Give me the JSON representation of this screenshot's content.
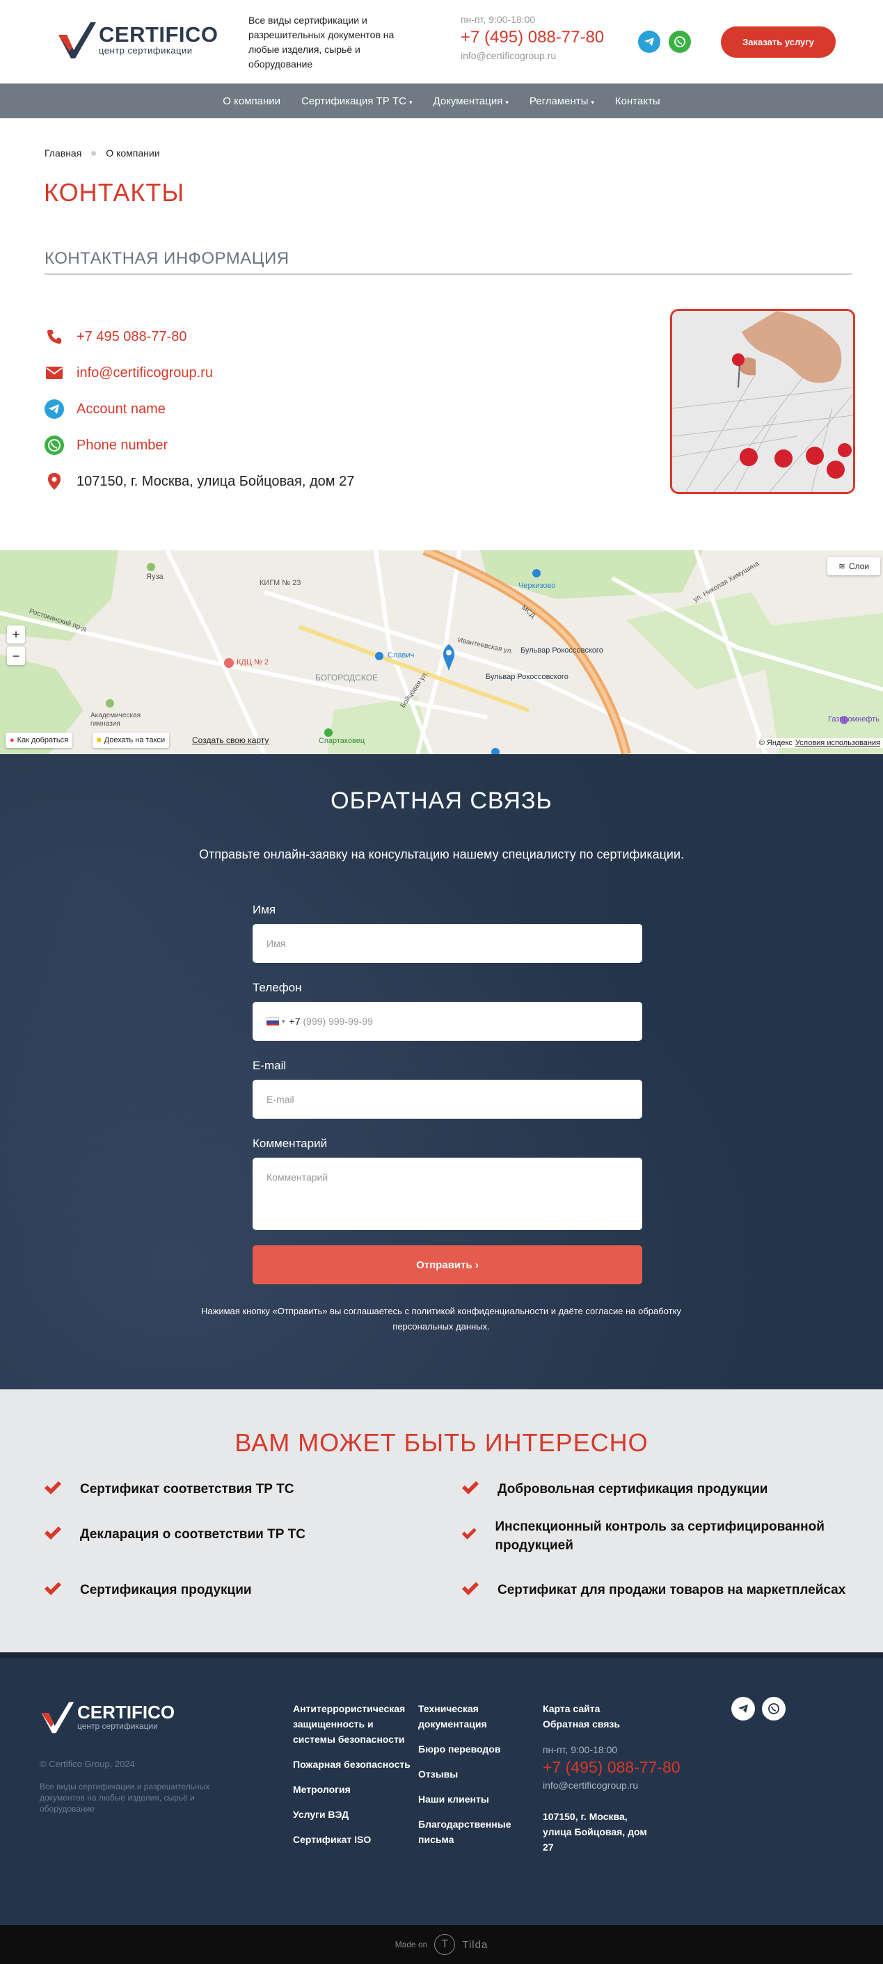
{
  "header": {
    "logo_title": "CERTIFICO",
    "logo_sub": "центр сертификации",
    "desc": "Все виды сертификации и разрешительных документов на любые изделия, сырьё и оборудование",
    "hours": "пн-пт, 9:00-18:00",
    "phone": "+7 (495) 088-77-80",
    "email": "info@certificogroup.ru",
    "order_button": "Заказать услугу",
    "telegram_icon": "telegram-icon",
    "whatsapp_icon": "whatsapp-icon"
  },
  "nav": {
    "items": [
      {
        "label": "О компании",
        "caret": false
      },
      {
        "label": "Сертификация ТР ТС",
        "caret": true
      },
      {
        "label": "Документация",
        "caret": true
      },
      {
        "label": "Регламенты",
        "caret": true
      },
      {
        "label": "Контакты",
        "caret": false
      }
    ],
    "caret_glyph": "▾"
  },
  "breadcrumb": {
    "home": "Главная",
    "current": "О компании"
  },
  "page_title": "КОНТАКТЫ",
  "contact_section": {
    "title": "КОНТАКТНАЯ ИНФОРМАЦИЯ",
    "phone": "+7 495 088-77-80",
    "email": "info@certificogroup.ru",
    "telegram": "Account name",
    "whatsapp": "Phone number",
    "address": "107150, г. Москва, улица Бойцовая, дом 27"
  },
  "map": {
    "layers_button": "Слои",
    "route_button": "Как добраться",
    "taxi_button": "Доехать на такси",
    "create_map_link": "Создать свою карту",
    "copyright": "© Яндекс",
    "terms_link": "Условия использования",
    "labels": {
      "yauza": "Яуза",
      "kigm": "КИГМ № 23",
      "cherkizovo": "Черкизово",
      "mkd": "МСД",
      "kdc": "КДЦ № 2",
      "slavich": "Славич",
      "bogorodskoe": "БОГОРОДСКОЕ",
      "bulvar1": "Бульвар Рокоссовского",
      "bulvar2": "Бульвар Рокоссовского",
      "akadem": "Академическая гимназия",
      "spartakovec": "Спартаковец",
      "gazprom": "Газпромнефть",
      "rostokinsky": "Ростокинский пр-д",
      "ivanteevskaya": "Ивантеевская ул.",
      "boytsovaya": "Бойцовая ул.",
      "nikolaya_khimushina": "ул. Николая Химушина"
    }
  },
  "feedback": {
    "title": "ОБРАТНАЯ СВЯЗЬ",
    "subtitle": "Отправьте онлайн-заявку на консультацию нашему специалисту по сертификации.",
    "name_label": "Имя",
    "name_placeholder": "Имя",
    "phone_label": "Телефон",
    "phone_code": "+7",
    "phone_placeholder": "(999) 999-99-99",
    "email_label": "E-mail",
    "email_placeholder": "E-mail",
    "comment_label": "Комментарий",
    "comment_placeholder": "Комментарий",
    "submit": "Отправить ›",
    "note": "Нажимая кнопку «Отправить» вы соглашаетесь с политикой конфиденциальности и даёте согласие на обработку персональных данных."
  },
  "interesting": {
    "title": "ВАМ МОЖЕТ БЫТЬ ИНТЕРЕСНО",
    "items": [
      "Сертификат соответствия ТР ТС",
      "Добровольная сертификация продукции",
      "Декларация о соответствии ТР ТС",
      "Инспекционный контроль за сертифицированной продукцией",
      "Сертификация продукции",
      "Сертификат для продажи товаров на маркетплейсах"
    ]
  },
  "footer": {
    "logo_title": "CERTIFICO",
    "logo_sub": "центр сертификации",
    "copyright": "© Certifico Group, 2024",
    "desc": "Все виды сертификации и разрешительных документов на любые изделия, сырьё и оборудование",
    "col1": [
      "Антитеррористическая защищенность и системы безопасности",
      "Пожарная безопасность",
      "Метрология",
      "Услуги ВЭД",
      "Сертификат ISO"
    ],
    "col2": [
      "Техническая документация",
      "Бюро переводов",
      "Отзывы",
      "Наши клиенты",
      "Благодарственные письма"
    ],
    "col3": [
      "Карта сайта",
      "Обратная связь"
    ],
    "hours": "пн-пт, 9:00-18:00",
    "phone": "+7 (495) 088-77-80",
    "email": "info@certificogroup.ru",
    "address": "107150, г. Москва, улица Бойцовая, дом 27"
  },
  "tilda": {
    "made_on": "Made on",
    "name": "Tilda"
  },
  "colors": {
    "accent": "#d7392b",
    "nav": "#6f7a85",
    "dark": "#24344a",
    "light": "#e7e8ea"
  }
}
